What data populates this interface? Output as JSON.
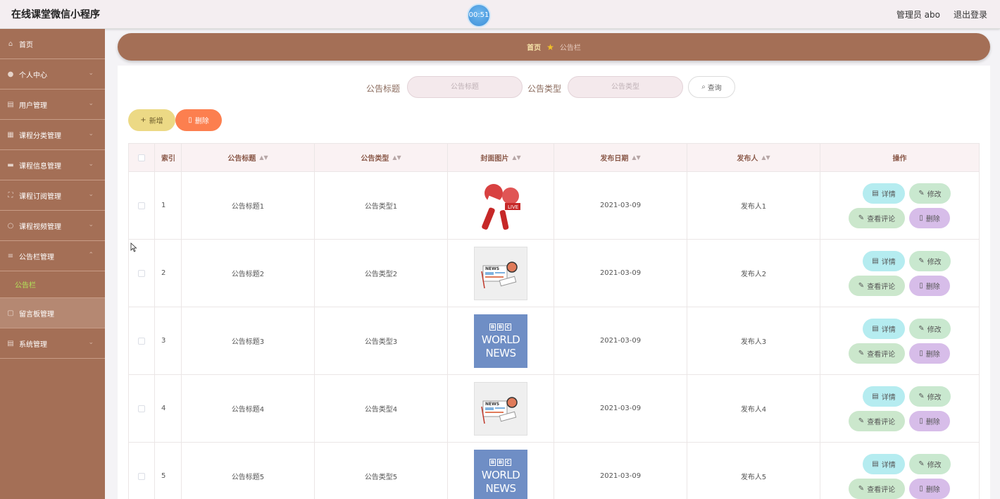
{
  "header": {
    "app_title": "在线课堂微信小程序",
    "timer": "00:51",
    "user": "管理员 abo",
    "logout": "退出登录"
  },
  "sidebar": {
    "items": [
      {
        "label": "首页",
        "icon": "home-icon",
        "chevron": false
      },
      {
        "label": "个人中心",
        "icon": "user-icon",
        "chevron": true
      },
      {
        "label": "用户管理",
        "icon": "list-icon",
        "chevron": true
      },
      {
        "label": "课程分类管理",
        "icon": "folder-icon",
        "chevron": true
      },
      {
        "label": "课程信息管理",
        "icon": "document-icon",
        "chevron": true
      },
      {
        "label": "课程订阅管理",
        "icon": "frame-icon",
        "chevron": true
      },
      {
        "label": "课程视频管理",
        "icon": "video-icon",
        "chevron": true
      },
      {
        "label": "公告栏管理",
        "icon": "menu-icon",
        "chevron": true,
        "expanded": true
      },
      {
        "label": "公告栏",
        "sub": true
      },
      {
        "label": "留言板管理",
        "icon": "message-icon",
        "chevron": false,
        "active": true
      },
      {
        "label": "系统管理",
        "icon": "settings-icon",
        "chevron": true
      }
    ]
  },
  "breadcrumb": {
    "home": "首页",
    "current": "公告栏"
  },
  "search": {
    "title_label": "公告标题",
    "title_placeholder": "公告标题",
    "type_label": "公告类型",
    "type_placeholder": "公告类型",
    "query_button": "查询"
  },
  "toolbar": {
    "add_label": "新增",
    "delete_label": "删除"
  },
  "table": {
    "columns": [
      "索引",
      "公告标题",
      "公告类型",
      "封面图片",
      "发布日期",
      "发布人",
      "操作"
    ],
    "rows": [
      {
        "index": "1",
        "title": "公告标题1",
        "type": "公告类型1",
        "cover": "microphone-image",
        "date": "2021-03-09",
        "publisher": "发布人1"
      },
      {
        "index": "2",
        "title": "公告标题2",
        "type": "公告类型2",
        "cover": "news-image",
        "date": "2021-03-09",
        "publisher": "发布人2"
      },
      {
        "index": "3",
        "title": "公告标题3",
        "type": "公告类型3",
        "cover": "bbc-world-news-image",
        "date": "2021-03-09",
        "publisher": "发布人3"
      },
      {
        "index": "4",
        "title": "公告标题4",
        "type": "公告类型4",
        "cover": "news-image",
        "date": "2021-03-09",
        "publisher": "发布人4"
      },
      {
        "index": "5",
        "title": "公告标题5",
        "type": "公告类型5",
        "cover": "bbc-world-news-image",
        "date": "2021-03-09",
        "publisher": "发布人5"
      }
    ],
    "actions": {
      "detail": "详情",
      "edit": "修改",
      "comments": "查看评论",
      "delete": "删除"
    },
    "bbc_text": {
      "logo": [
        "B",
        "B",
        "C"
      ],
      "line1": "WORLD",
      "line2": "NEWS"
    },
    "news_text": "NEWS",
    "live_text": "LIVE"
  },
  "colors": {
    "sidebar": "#a46f56",
    "breadcrumb_bar": "#a46f56",
    "add_button": "#ecd985",
    "delete_button": "#fc7f4f",
    "detail_button": "#b5ecf0",
    "edit_button": "#c9e8cf",
    "comment_button": "#cbe7cc",
    "remove_button": "#d7bde9",
    "submenu_text": "#b2e35a"
  }
}
